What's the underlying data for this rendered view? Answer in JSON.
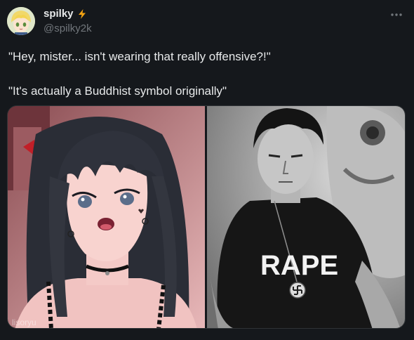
{
  "author": {
    "display_name": "spilky",
    "handle": "@spilky2k",
    "badge_icon": "lightning-bolt-icon",
    "badge_color": "#f4a312"
  },
  "tweet": {
    "line1": "\"Hey, mister... isn't wearing that really offensive?!\"",
    "line2": "\"It's actually a Buddhist symbol originally\""
  },
  "media": {
    "left_image": {
      "kind": "anime girl with black hair, mouth open, choker, black top",
      "watermark": "lisoryu"
    },
    "right_image": {
      "kind": "black-and-white photo of man in black t-shirt with pendant",
      "shirt_text": "RAPE"
    }
  },
  "colors": {
    "background": "#15181c",
    "text": "#e7e9ea",
    "muted": "#71767b"
  }
}
